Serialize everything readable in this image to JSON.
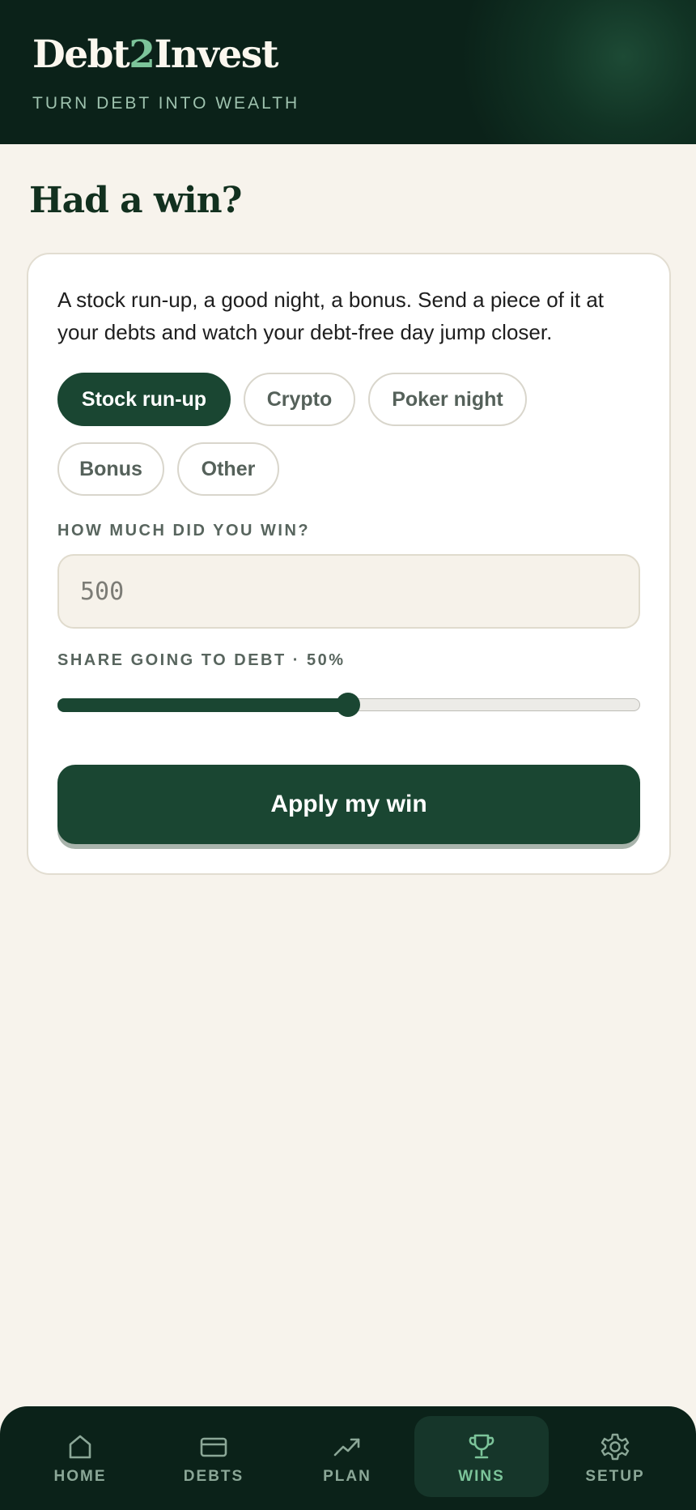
{
  "header": {
    "logo_prefix": "Debt",
    "logo_accent": "2",
    "logo_suffix": "Invest",
    "tagline": "TURN DEBT INTO WEALTH"
  },
  "page": {
    "title": "Had a win?"
  },
  "win_form": {
    "intro": "A stock run-up, a good night, a bonus. Send a piece of it at your debts and watch your debt-free day jump closer.",
    "categories": [
      {
        "label": "Stock run-up",
        "selected": true
      },
      {
        "label": "Crypto",
        "selected": false
      },
      {
        "label": "Poker night",
        "selected": false
      },
      {
        "label": "Bonus",
        "selected": false
      },
      {
        "label": "Other",
        "selected": false
      }
    ],
    "amount_label": "HOW MUCH DID YOU WIN?",
    "amount_placeholder": "500",
    "amount_value": "",
    "share_label": "SHARE GOING TO DEBT · 50%",
    "share_percent": 50,
    "apply_label": "Apply my win"
  },
  "nav": {
    "items": [
      {
        "label": "HOME",
        "icon": "home-icon",
        "active": false
      },
      {
        "label": "DEBTS",
        "icon": "card-icon",
        "active": false
      },
      {
        "label": "PLAN",
        "icon": "trend-up-icon",
        "active": false
      },
      {
        "label": "WINS",
        "icon": "trophy-icon",
        "active": true
      },
      {
        "label": "SETUP",
        "icon": "gear-icon",
        "active": false
      }
    ]
  },
  "colors": {
    "brand_dark": "#0b2219",
    "brand_green": "#1a4632",
    "accent_green": "#7cc49a",
    "background": "#f7f3ec"
  }
}
